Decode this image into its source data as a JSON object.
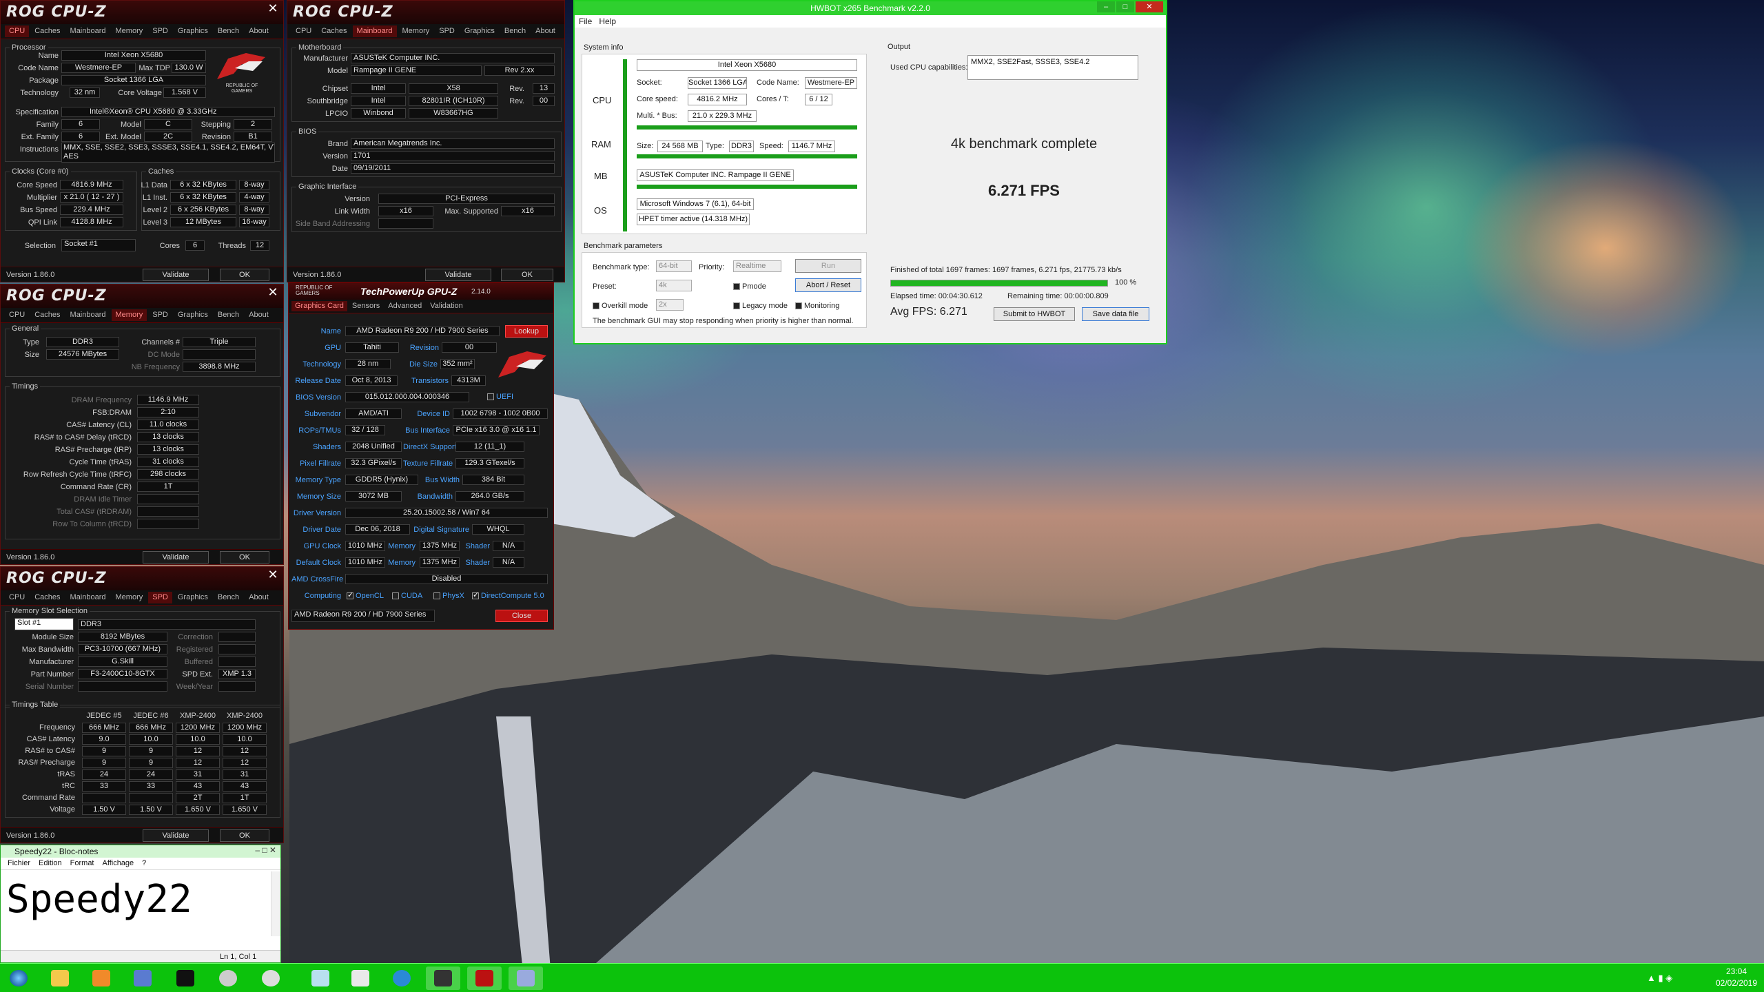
{
  "cpuz_cpu": {
    "title": "ROG CPU-Z",
    "tabs": [
      "CPU",
      "Caches",
      "Mainboard",
      "Memory",
      "SPD",
      "Graphics",
      "Bench",
      "About"
    ],
    "active": "CPU",
    "processor_group": "Processor",
    "name_l": "Name",
    "name": "Intel Xeon X5680",
    "codename_l": "Code Name",
    "codename": "Westmere-EP",
    "maxtdp_l": "Max TDP",
    "maxtdp": "130.0 W",
    "package_l": "Package",
    "package": "Socket 1366 LGA",
    "tech_l": "Technology",
    "tech": "32 nm",
    "corev_l": "Core Voltage",
    "corev": "1.568 V",
    "spec_l": "Specification",
    "spec": "Intel®Xeon® CPU        X5680  @ 3.33GHz",
    "family_l": "Family",
    "family": "6",
    "model_l": "Model",
    "model": "C",
    "stepping_l": "Stepping",
    "stepping": "2",
    "extfamily_l": "Ext. Family",
    "extfamily": "6",
    "extmodel_l": "Ext. Model",
    "extmodel": "2C",
    "revision_l": "Revision",
    "revision": "B1",
    "instr_l": "Instructions",
    "instr": "MMX, SSE, SSE2, SSE3, SSSE3, SSE4.1, SSE4.2, EM64T, VT-x,",
    "instr2": "AES",
    "clocks_group": "Clocks (Core #0)",
    "corespeed_l": "Core Speed",
    "corespeed": "4816.9 MHz",
    "mult_l": "Multiplier",
    "mult": "x 21.0 ( 12 - 27 )",
    "bus_l": "Bus Speed",
    "bus": "229.4 MHz",
    "qpi_l": "QPI Link",
    "qpi": "4128.8 MHz",
    "caches_group": "Caches",
    "l1d_l": "L1 Data",
    "l1d": "6 x 32 KBytes",
    "l1d_w": "8-way",
    "l1i_l": "L1 Inst.",
    "l1i": "6 x 32 KBytes",
    "l1i_w": "4-way",
    "l2_l": "Level 2",
    "l2": "6 x 256 KBytes",
    "l2_w": "8-way",
    "l3_l": "Level 3",
    "l3": "12 MBytes",
    "l3_w": "16-way",
    "selection_l": "Selection",
    "selection": "Socket #1",
    "cores_l": "Cores",
    "cores": "6",
    "threads_l": "Threads",
    "threads": "12",
    "version": "Version 1.86.0",
    "validate": "Validate",
    "ok": "OK",
    "logo_text": "REPUBLIC OF GAMERS"
  },
  "cpuz_mb": {
    "title": "ROG CPU-Z",
    "tabs": [
      "CPU",
      "Caches",
      "Mainboard",
      "Memory",
      "SPD",
      "Graphics",
      "Bench",
      "About"
    ],
    "active": "Mainboard",
    "mb_group": "Motherboard",
    "manuf_l": "Manufacturer",
    "manuf": "ASUSTeK Computer INC.",
    "model_l": "Model",
    "model": "Rampage II GENE",
    "rev": "Rev 2.xx",
    "chipset_l": "Chipset",
    "chipset": "Intel",
    "chipset2": "X58",
    "chipset_rev_l": "Rev.",
    "chipset_rev": "13",
    "south_l": "Southbridge",
    "south": "Intel",
    "south2": "82801IR (ICH10R)",
    "south_rev_l": "Rev.",
    "south_rev": "00",
    "lpcio_l": "LPCIO",
    "lpcio": "Winbond",
    "lpcio2": "W83667HG",
    "bios_group": "BIOS",
    "brand_l": "Brand",
    "brand": "American Megatrends Inc.",
    "biosver_l": "Version",
    "biosver": "1701",
    "date_l": "Date",
    "date": "09/19/2011",
    "gi_group": "Graphic Interface",
    "giver_l": "Version",
    "giver": "PCI-Express",
    "lw_l": "Link Width",
    "lw": "x16",
    "ms_l": "Max. Supported",
    "ms": "x16",
    "sba_l": "Side Band Addressing",
    "version": "Version 1.86.0",
    "validate": "Validate",
    "ok": "OK"
  },
  "cpuz_mem": {
    "title": "ROG CPU-Z",
    "tabs": [
      "CPU",
      "Caches",
      "Mainboard",
      "Memory",
      "SPD",
      "Graphics",
      "Bench",
      "About"
    ],
    "active": "Memory",
    "gen_group": "General",
    "type_l": "Type",
    "type": "DDR3",
    "size_l": "Size",
    "size": "24576 MBytes",
    "channels_l": "Channels #",
    "channels": "Triple",
    "dc_l": "DC Mode",
    "nb_l": "NB Frequency",
    "nb": "3898.8 MHz",
    "tim_group": "Timings",
    "rows": [
      [
        "DRAM Frequency",
        "1146.9 MHz",
        true
      ],
      [
        "FSB:DRAM",
        "2:10",
        false
      ],
      [
        "CAS# Latency (CL)",
        "11.0 clocks",
        false
      ],
      [
        "RAS# to CAS# Delay (tRCD)",
        "13 clocks",
        false
      ],
      [
        "RAS# Precharge (tRP)",
        "13 clocks",
        false
      ],
      [
        "Cycle Time (tRAS)",
        "31 clocks",
        false
      ],
      [
        "Row Refresh Cycle Time (tRFC)",
        "298 clocks",
        false
      ],
      [
        "Command Rate (CR)",
        "1T",
        false
      ],
      [
        "DRAM Idle Timer",
        "",
        true
      ],
      [
        "Total CAS# (tRDRAM)",
        "",
        true
      ],
      [
        "Row To Column (tRCD)",
        "",
        true
      ]
    ],
    "version": "Version 1.86.0",
    "validate": "Validate",
    "ok": "OK"
  },
  "cpuz_spd": {
    "title": "ROG CPU-Z",
    "tabs": [
      "CPU",
      "Caches",
      "Mainboard",
      "Memory",
      "SPD",
      "Graphics",
      "Bench",
      "About"
    ],
    "active": "SPD",
    "slot_group": "Memory Slot Selection",
    "slot": "Slot #1",
    "slot_type": "DDR3",
    "modsize_l": "Module Size",
    "modsize": "8192 MBytes",
    "corr_l": "Correction",
    "maxbw_l": "Max Bandwidth",
    "maxbw": "PC3-10700 (667 MHz)",
    "reg_l": "Registered",
    "manuf_l": "Manufacturer",
    "manuf": "G.Skill",
    "buf_l": "Buffered",
    "part_l": "Part Number",
    "part": "F3-2400C10-8GTX",
    "spdext_l": "SPD Ext.",
    "spdext": "XMP 1.3",
    "serial_l": "Serial Number",
    "week_l": "Week/Year",
    "tt_group": "Timings Table",
    "cols": [
      "JEDEC #5",
      "JEDEC #6",
      "XMP-2400",
      "XMP-2400"
    ],
    "trows": [
      [
        "Frequency",
        "666 MHz",
        "666 MHz",
        "1200 MHz",
        "1200 MHz"
      ],
      [
        "CAS# Latency",
        "9.0",
        "10.0",
        "10.0",
        "10.0"
      ],
      [
        "RAS# to CAS#",
        "9",
        "9",
        "12",
        "12"
      ],
      [
        "RAS# Precharge",
        "9",
        "9",
        "12",
        "12"
      ],
      [
        "tRAS",
        "24",
        "24",
        "31",
        "31"
      ],
      [
        "tRC",
        "33",
        "33",
        "43",
        "43"
      ],
      [
        "Command Rate",
        "",
        "",
        "2T",
        "1T"
      ],
      [
        "Voltage",
        "1.50 V",
        "1.50 V",
        "1.650 V",
        "1.650 V"
      ]
    ],
    "version": "Version 1.86.0",
    "validate": "Validate",
    "ok": "OK"
  },
  "gpuz": {
    "title": "TechPowerUp GPU-Z",
    "ver": "2.14.0",
    "brand": "REPUBLIC OF GAMERS",
    "tabs": [
      "Graphics Card",
      "Sensors",
      "Advanced",
      "Validation"
    ],
    "name_l": "Name",
    "name": "AMD Radeon R9 200 / HD 7900 Series",
    "lookup": "Lookup",
    "gpu_l": "GPU",
    "gpu": "Tahiti",
    "rev_l": "Revision",
    "rev": "00",
    "tech_l": "Technology",
    "tech": "28 nm",
    "die_l": "Die Size",
    "die": "352 mm²",
    "rel_l": "Release Date",
    "rel": "Oct 8, 2013",
    "trans_l": "Transistors",
    "trans": "4313M",
    "bios_l": "BIOS Version",
    "bios": "015.012.000.004.000346",
    "uefi": "UEFI",
    "subv_l": "Subvendor",
    "subv": "AMD/ATI",
    "devid_l": "Device ID",
    "devid": "1002 6798 - 1002 0B00",
    "rops_l": "ROPs/TMUs",
    "rops": "32 / 128",
    "busi_l": "Bus Interface",
    "busi": "PCIe x16 3.0 @ x16 1.1",
    "shaders_l": "Shaders",
    "shaders": "2048 Unified",
    "dx_l": "DirectX Support",
    "dx": "12 (11_1)",
    "pix_l": "Pixel Fillrate",
    "pix": "32.3 GPixel/s",
    "tex_l": "Texture Fillrate",
    "tex": "129.3 GTexel/s",
    "mtype_l": "Memory Type",
    "mtype": "GDDR5 (Hynix)",
    "bw_l": "Bus Width",
    "bw": "384 Bit",
    "msize_l": "Memory Size",
    "msize": "3072 MB",
    "band_l": "Bandwidth",
    "band": "264.0 GB/s",
    "drv_l": "Driver Version",
    "drv": "25.20.15002.58 / Win7 64",
    "ddate_l": "Driver Date",
    "ddate": "Dec 06, 2018",
    "sig_l": "Digital Signature",
    "sig": "WHQL",
    "gclk_l": "GPU Clock",
    "gclk": "1010 MHz",
    "mem_l": "Memory",
    "mem": "1375 MHz",
    "shd_l": "Shader",
    "shd": "N/A",
    "dclk_l": "Default Clock",
    "dclk": "1010 MHz",
    "mem2": "1375 MHz",
    "shd2": "N/A",
    "cf_l": "AMD CrossFire",
    "cf": "Disabled",
    "comp_l": "Computing",
    "opencl": "OpenCL",
    "cuda": "CUDA",
    "physx": "PhysX",
    "dcomp": "DirectCompute 5.0",
    "sel": "AMD Radeon R9 200 / HD 7900 Series",
    "close": "Close"
  },
  "hwbot": {
    "title": "HWBOT x265 Benchmark v2.2.0",
    "menu": [
      "File",
      "Help"
    ],
    "sysinfo": "System info",
    "output": "Output",
    "cpu_l": "CPU",
    "cpu": "Intel Xeon X5680",
    "socket_l": "Socket:",
    "socket": "Socket 1366 LGA",
    "codename_l": "Code Name:",
    "codename": "Westmere-EP",
    "cs_l": "Core speed:",
    "cs": "4816.2 MHz",
    "ct_l": "Cores / T:",
    "ct": "6 / 12",
    "mb_l": "Multi. * Bus:",
    "mb": "21.0 x 229.3 MHz",
    "ram_l": "RAM",
    "size_l": "Size:",
    "size": "24 568 MB",
    "type_l": "Type:",
    "type": "DDR3",
    "speed_l": "Speed:",
    "speed": "1146.7 MHz",
    "mbd_l": "MB",
    "mbd": "ASUSTeK Computer INC. Rampage II GENE",
    "os_l": "OS",
    "os": "Microsoft Windows 7 (6.1), 64-bit",
    "hpet": "HPET timer active (14.318 MHz)",
    "caps_l": "Used CPU capabilities:",
    "caps": "MMX2, SSE2Fast, SSSE3, SSE4.2",
    "complete": "4k benchmark complete",
    "fps": "6.271 FPS",
    "bp": "Benchmark parameters",
    "bt_l": "Benchmark type:",
    "bt": "64-bit",
    "prio_l": "Priority:",
    "prio": "Realtime",
    "run": "Run",
    "preset_l": "Preset:",
    "preset": "4k",
    "pmode": "Pmode",
    "abort": "Abort / Reset",
    "overkill": "Overkill mode",
    "ok_v": "2x",
    "legacy": "Legacy mode",
    "monitoring": "Monitoring",
    "note": "The benchmark GUI may stop responding when priority is higher than normal.",
    "finished": "Finished of total 1697 frames: 1697 frames, 6.271 fps,  21775.73 kb/s",
    "progress": 1.0,
    "pct": "100 %",
    "elapsed": "Elapsed time: 00:04:30.612",
    "remaining": "Remaining time: 00:00:00.809",
    "avg": "Avg FPS: 6.271",
    "submit": "Submit to HWBOT",
    "save": "Save data file"
  },
  "notepad": {
    "title": "Speedy22 - Bloc-notes",
    "menu": [
      "Fichier",
      "Edition",
      "Format",
      "Affichage",
      "?"
    ],
    "text": "Speedy22",
    "status": "Ln 1, Col 1"
  },
  "taskbar": {
    "time": "23:04",
    "date": "02/02/2019"
  }
}
